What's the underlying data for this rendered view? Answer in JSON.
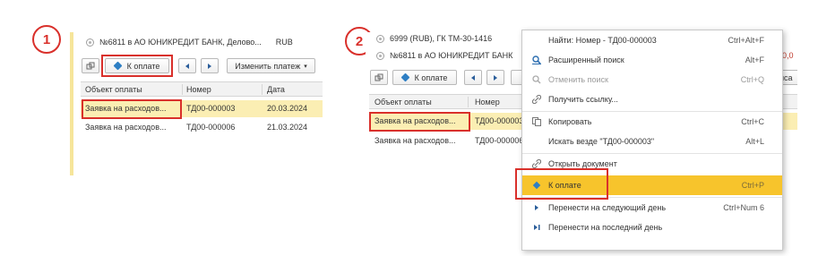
{
  "step1": {
    "number": "1",
    "accounts": [
      {
        "name": "№6811 в АО ЮНИКРЕДИТ БАНК, Делово...",
        "currency": "RUB"
      }
    ],
    "toolbar": {
      "pay_label": "К оплате",
      "change_label": "Изменить платеж"
    },
    "columns": [
      "Объект оплаты",
      "Номер",
      "Дата"
    ],
    "rows": [
      {
        "object": "Заявка на расходов...",
        "number": "ТД00-000003",
        "date": "20.03.2024"
      },
      {
        "object": "Заявка на расходов...",
        "number": "ТД00-000006",
        "date": "21.03.2024"
      }
    ]
  },
  "step2": {
    "number": "2",
    "accounts": [
      {
        "name": "6999 (RUB), ГК ТМ-30-1416"
      },
      {
        "name": "№6811 в АО ЮНИКРЕДИТ БАНК"
      }
    ],
    "right_clip": {
      "value": "30,0",
      "tab": "иса"
    },
    "toolbar": {
      "pay_label": "К оплате"
    },
    "columns": [
      "Объект оплаты",
      "Номер"
    ],
    "rows": [
      {
        "object": "Заявка на расходов...",
        "number": "ТД00-000003"
      },
      {
        "object": "Заявка на расходов...",
        "number": "ТД00-000006"
      }
    ],
    "menu": {
      "items": [
        {
          "label": "Найти: Номер - ТД00-000003",
          "shortcut": "Ctrl+Alt+F",
          "icon": "none",
          "disabled": false
        },
        {
          "label": "Расширенный поиск",
          "shortcut": "Alt+F",
          "icon": "search-icon",
          "disabled": false
        },
        {
          "label": "Отменить поиск",
          "shortcut": "Ctrl+Q",
          "icon": "cancel-search-icon",
          "disabled": true
        },
        {
          "label": "Получить ссылку...",
          "shortcut": "",
          "icon": "link-icon",
          "disabled": false
        },
        {
          "label": "Копировать",
          "shortcut": "Ctrl+C",
          "icon": "copy-icon",
          "disabled": false
        },
        {
          "label": "Искать везде \"ТД00-000003\"",
          "shortcut": "Alt+L",
          "icon": "none",
          "disabled": false
        },
        {
          "label": "Открыть документ",
          "shortcut": "",
          "icon": "open-document-icon",
          "disabled": false
        },
        {
          "label": "К оплате",
          "shortcut": "Ctrl+P",
          "icon": "pay-icon",
          "disabled": false,
          "highlighted": true
        },
        {
          "label": "Перенести на следующий день",
          "shortcut": "Ctrl+Num 6",
          "icon": "arrow-right-icon",
          "disabled": false
        },
        {
          "label": "Перенести на последний день",
          "shortcut": "",
          "icon": "arrow-end-icon",
          "disabled": false
        }
      ]
    }
  },
  "colors": {
    "highlight": "#f7c42c",
    "selected_row": "#fbeeb3",
    "annotation": "#d9302b",
    "accent_bar": "#f6e59a"
  }
}
